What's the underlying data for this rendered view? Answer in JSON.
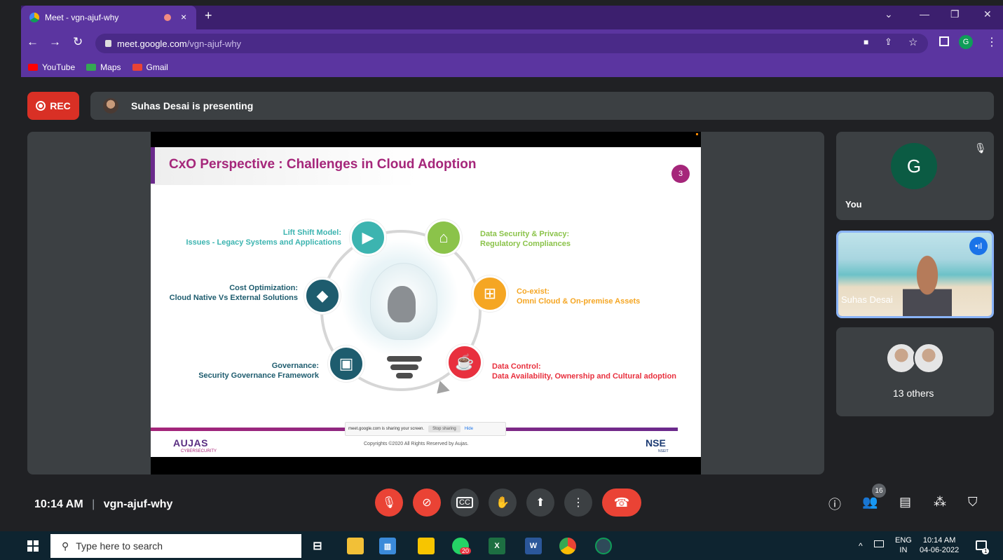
{
  "browser": {
    "tab_title": "Meet - vgn-ajuf-why",
    "tab_close": "×",
    "new_tab": "+",
    "url_host": "meet.google.com",
    "url_path": "/vgn-ajuf-why",
    "profile_initial": "G",
    "bookmarks": [
      {
        "label": "YouTube",
        "color": "#ff0000"
      },
      {
        "label": "Maps",
        "color": "#34a853"
      },
      {
        "label": "Gmail",
        "color": "#ea4335"
      }
    ]
  },
  "meet": {
    "rec_label": "REC",
    "presenting_text": "Suhas Desai is presenting",
    "time": "10:14 AM",
    "meeting_code": "vgn-ajuf-why",
    "participants_count": "16",
    "tiles": {
      "you_initial": "G",
      "you_label": "You",
      "speaker_name": "Suhas Desai",
      "others_label": "13 others"
    }
  },
  "slide": {
    "title": "CxO Perspective : Challenges in Cloud Adoption",
    "page_number": "3",
    "items": [
      {
        "heading": "Lift Shift Model:",
        "detail": "Issues - Legacy Systems and Applications",
        "color": "#3cb4b0"
      },
      {
        "heading": "Data Security & Privacy:",
        "detail": "Regulatory Compliances",
        "color": "#8bc34a"
      },
      {
        "heading": "Cost Optimization:",
        "detail": "Cloud Native Vs External Solutions",
        "color": "#1e5c6e"
      },
      {
        "heading": "Co-exist:",
        "detail": "Omni Cloud & On-premise Assets",
        "color": "#f5a623"
      },
      {
        "heading": "Governance:",
        "detail": "Security Governance Framework",
        "color": "#1e5c6e"
      },
      {
        "heading": "Data Control:",
        "detail": "Data Availability, Ownership and Cultural adoption",
        "color": "#e8303e"
      }
    ],
    "footer_logo": "AUJAS",
    "footer_logo_sub": "CYBERSECURITY",
    "copyright": "Copyrights ©2020 All Rights Reserved by Aujas.",
    "partner_logo": "NSE",
    "partner_sub": "NSEIT",
    "share_notice": "meet.google.com is sharing your screen.",
    "stop_sharing": "Stop sharing",
    "hide": "Hide"
  },
  "taskbar": {
    "search_placeholder": "Type here to search",
    "lang": "ENG",
    "region": "IN",
    "time": "10:14 AM",
    "date": "04-06-2022",
    "whatsapp_badge": "20",
    "notification_count": "1"
  }
}
